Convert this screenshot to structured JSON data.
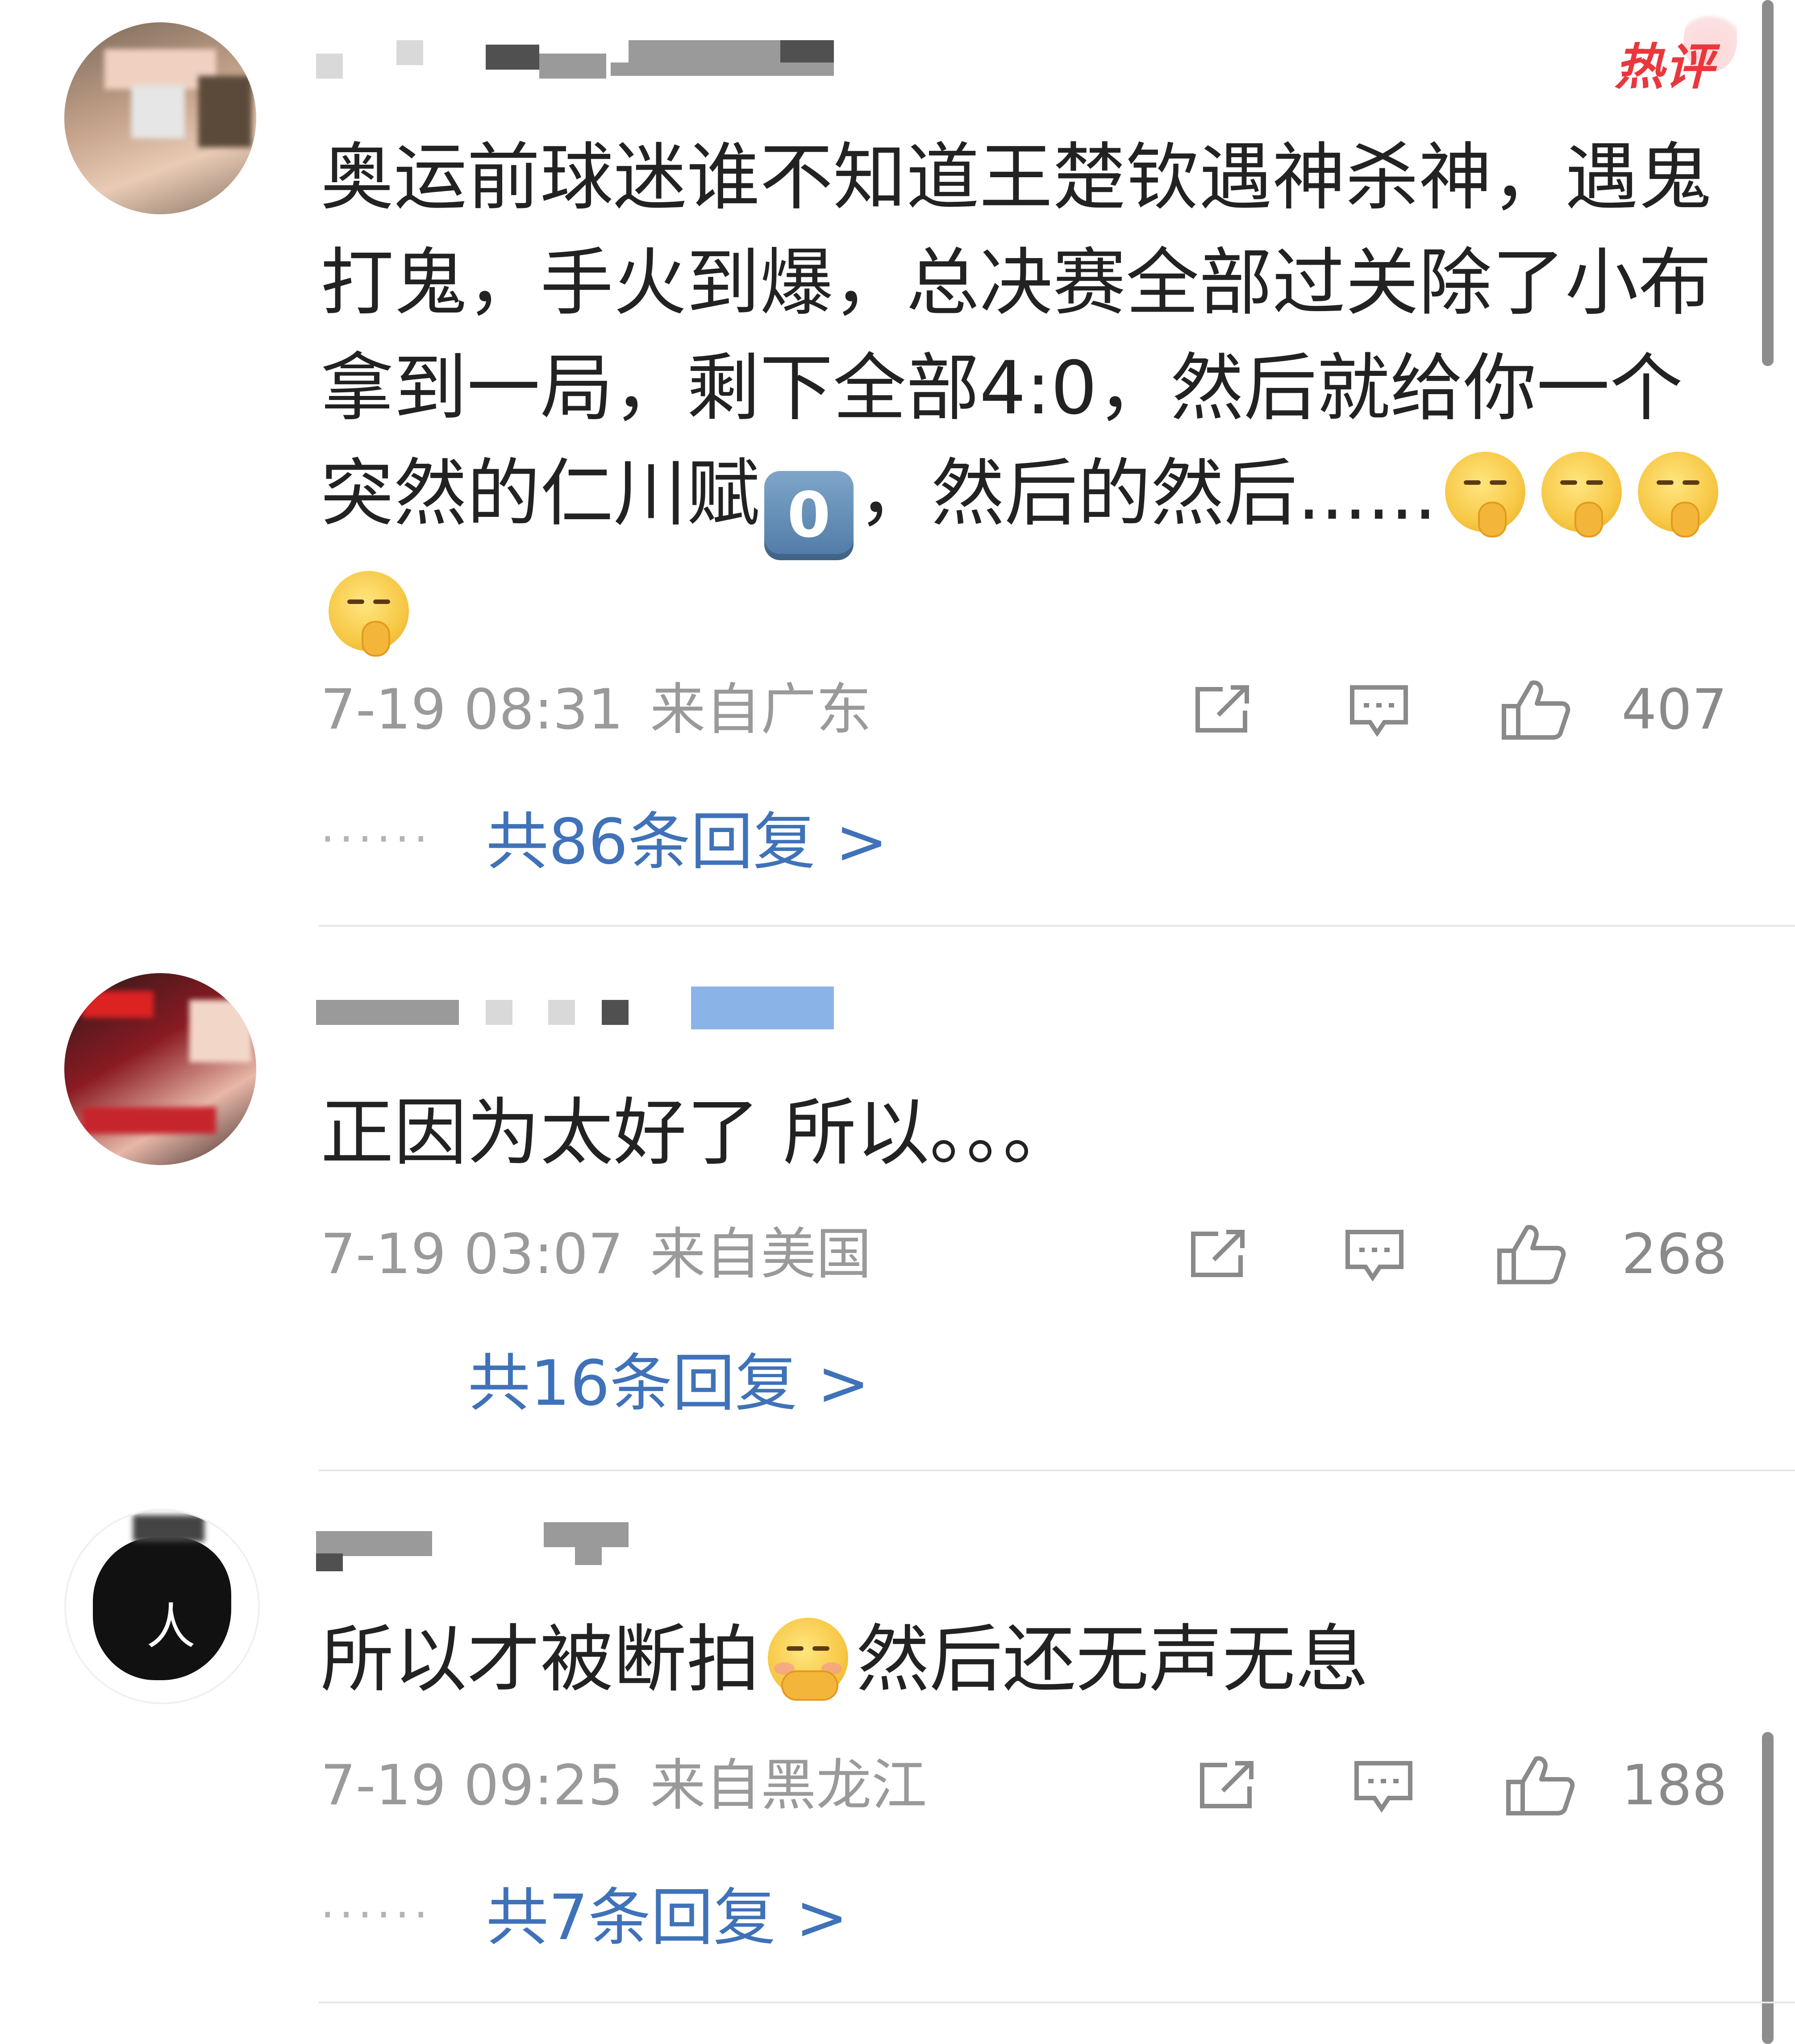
{
  "comments": [
    {
      "hot_badge": "热评",
      "text_before_key": "奥运前球迷谁不知道王楚钦遇神杀神，遇鬼打鬼，手火到爆，总决赛全部过关除了小布拿到一局，剩下全部4:0，然后就给你一个突然的仁川赋",
      "keycap": "0",
      "text_after_key": "，然后的然后......",
      "emoji": [
        "shushing-face-emoji",
        "shushing-face-emoji",
        "shushing-face-emoji",
        "shushing-face-emoji"
      ],
      "time": "7-19 08:31",
      "location": "来自广东",
      "likes": "407",
      "replies": "共86条回复 >",
      "replies_prefix": "······"
    },
    {
      "text": "正因为太好了 所以。。。",
      "time": "7-19 03:07",
      "location": "来自美国",
      "likes": "268",
      "replies": "共16条回复 >"
    },
    {
      "text_before_emoji": "所以才被断拍",
      "emoji": "shy-face-emoji",
      "text_after_emoji": "然后还无声无息",
      "time": "7-19 09:25",
      "location": "来自黑龙江",
      "likes": "188",
      "replies": "共7条回复 >",
      "replies_prefix": "······"
    }
  ],
  "icons": {
    "share": "share-icon",
    "comment": "comment-icon",
    "like": "thumbs-up-icon"
  },
  "colors": {
    "link": "#3f72b8",
    "hot": "#e8383d",
    "meta": "#9a9a9a"
  }
}
